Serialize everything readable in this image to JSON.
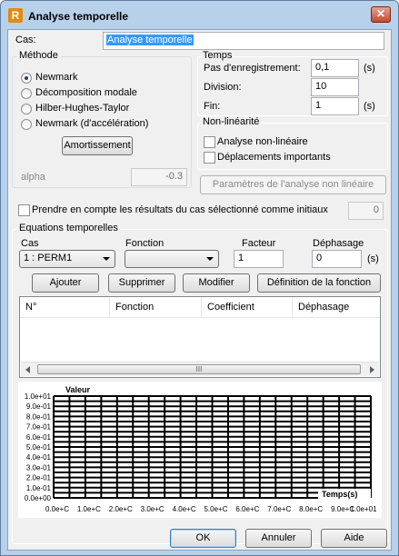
{
  "window": {
    "title": "Analyse temporelle",
    "close_glyph": "✕",
    "app_icon": "robot-logo-icon"
  },
  "cas": {
    "label": "Cas:",
    "value": "Analyse temporelle"
  },
  "methode": {
    "title": "Méthode",
    "options": [
      "Newmark",
      "Décomposition modale",
      "Hilber-Hughes-Taylor",
      "Newmark (d'accélération)"
    ],
    "selected": 0,
    "amortissement_label": "Amortissement",
    "alpha_label": "alpha",
    "alpha_value": "-0.3"
  },
  "temps": {
    "title": "Temps",
    "pas_label": "Pas d'enregistrement:",
    "pas_value": "0,1",
    "pas_unit": "(s)",
    "division_label": "Division:",
    "division_value": "10",
    "fin_label": "Fin:",
    "fin_value": "1",
    "fin_unit": "(s)"
  },
  "non_linearite": {
    "title": "Non-linéarité",
    "analyse_label": "Analyse non-linéaire",
    "deplacements_label": "Déplacements importants",
    "params_button": "Paramètres de l'analyse non linéaire"
  },
  "prendre": {
    "label": "Prendre en compte les résultats du cas sélectionné comme initiaux",
    "value": "0"
  },
  "equations": {
    "title": "Equations temporelles",
    "cas_label": "Cas",
    "cas_value": "1 : PERM1",
    "fonction_label": "Fonction",
    "fonction_value": "",
    "facteur_label": "Facteur",
    "facteur_value": "1",
    "dephasage_label": "Déphasage",
    "dephasage_value": "0",
    "dephasage_unit": "(s)",
    "buttons": {
      "ajouter": "Ajouter",
      "supprimer": "Supprimer",
      "modifier": "Modifier",
      "definition": "Définition de la fonction"
    },
    "table_columns": [
      "N°",
      "Fonction",
      "Coefficient",
      "Déphasage"
    ],
    "scroll_thumb": "III"
  },
  "chart_data": {
    "type": "line",
    "ylabel": "Valeur",
    "xlabel": "Temps(s)",
    "ylim": [
      0,
      1
    ],
    "xlim": [
      0,
      10
    ],
    "y_ticks": [
      "0.0e+00",
      "1.0e-01",
      "2.0e-01",
      "3.0e-01",
      "4.0e-01",
      "5.0e-01",
      "6.0e-01",
      "7.0e-01",
      "8.0e-01",
      "9.0e-01",
      "1.0e+01"
    ],
    "x_ticks": [
      "0.0e+C",
      "1.0e+C",
      "2.0e+C",
      "3.0e+C",
      "4.0e+C",
      "5.0e+C",
      "6.0e+C",
      "7.0e+C",
      "8.0e+C",
      "9.0e+C",
      "1.0e+01"
    ],
    "grid": true,
    "series": []
  },
  "footer": {
    "ok": "OK",
    "annuler": "Annuler",
    "aide": "Aide"
  }
}
